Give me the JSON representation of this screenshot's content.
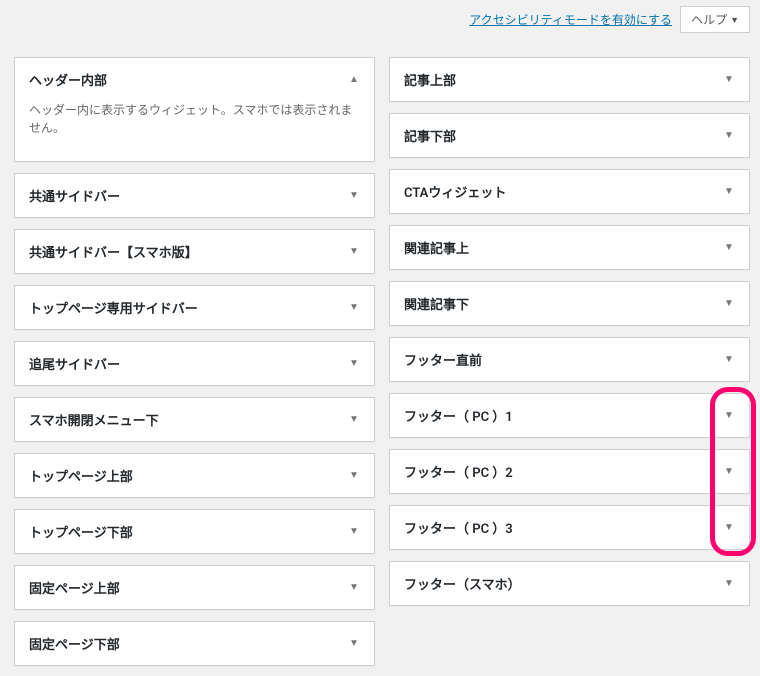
{
  "topbar": {
    "a11y_link": "アクセシビリティモードを有効にする",
    "help_label": "ヘルプ"
  },
  "left_column": [
    {
      "title": "ヘッダー内部",
      "expanded": true,
      "description": "ヘッダー内に表示するウィジェット。スマホでは表示されません。"
    },
    {
      "title": "共通サイドバー",
      "expanded": false
    },
    {
      "title": "共通サイドバー【スマホ版】",
      "expanded": false
    },
    {
      "title": "トップページ専用サイドバー",
      "expanded": false
    },
    {
      "title": "追尾サイドバー",
      "expanded": false
    },
    {
      "title": "スマホ開閉メニュー下",
      "expanded": false
    },
    {
      "title": "トップページ上部",
      "expanded": false
    },
    {
      "title": "トップページ下部",
      "expanded": false
    },
    {
      "title": "固定ページ上部",
      "expanded": false
    },
    {
      "title": "固定ページ下部",
      "expanded": false
    }
  ],
  "right_column": [
    {
      "title": "記事上部",
      "expanded": false
    },
    {
      "title": "記事下部",
      "expanded": false
    },
    {
      "title": "CTAウィジェット",
      "expanded": false
    },
    {
      "title": "関連記事上",
      "expanded": false
    },
    {
      "title": "関連記事下",
      "expanded": false
    },
    {
      "title": "フッター直前",
      "expanded": false
    },
    {
      "title": "フッター（ PC ）1",
      "expanded": false,
      "highlighted": true
    },
    {
      "title": "フッター（ PC ）2",
      "expanded": false,
      "highlighted": true
    },
    {
      "title": "フッター（ PC ）3",
      "expanded": false,
      "highlighted": true
    },
    {
      "title": "フッター（スマホ）",
      "expanded": false
    }
  ],
  "highlight": {
    "column": "right",
    "start_index": 6,
    "end_index": 8
  }
}
